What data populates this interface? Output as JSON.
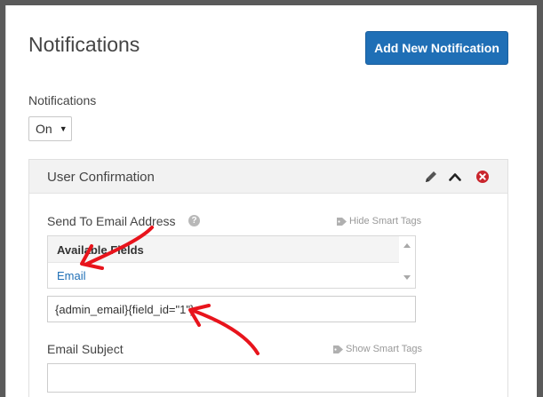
{
  "header": {
    "title": "Notifications",
    "add_button_label": "Add New Notification"
  },
  "notifications_toggle": {
    "label": "Notifications",
    "selected": "On"
  },
  "panel": {
    "title": "User Confirmation",
    "send_to": {
      "label": "Send To Email Address",
      "smart_tags_toggle": "Hide Smart Tags",
      "available_fields_title": "Available Fields",
      "fields": [
        "Email"
      ],
      "value": "{admin_email}{field_id=\"1\"}"
    },
    "subject": {
      "label": "Email Subject",
      "smart_tags_toggle": "Show Smart Tags",
      "value": ""
    }
  },
  "colors": {
    "primary": "#1f6fb6",
    "close": "#c9252c",
    "annotation": "#e8141c"
  }
}
